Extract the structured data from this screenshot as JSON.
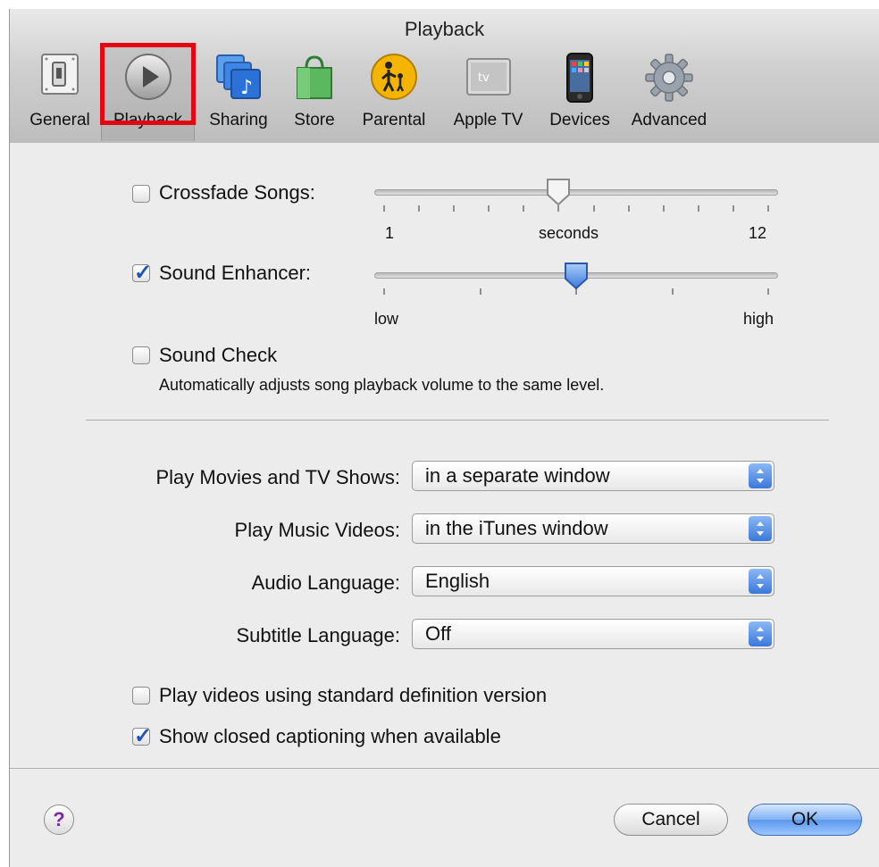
{
  "window": {
    "title": "Playback"
  },
  "toolbar": {
    "items": [
      {
        "label": "General",
        "icon": "switch-icon"
      },
      {
        "label": "Playback",
        "icon": "play-icon"
      },
      {
        "label": "Sharing",
        "icon": "sharing-icon"
      },
      {
        "label": "Store",
        "icon": "shopping-bag-icon"
      },
      {
        "label": "Parental",
        "icon": "parental-icon"
      },
      {
        "label": "Apple TV",
        "icon": "apple-tv-icon"
      },
      {
        "label": "Devices",
        "icon": "iphone-icon"
      },
      {
        "label": "Advanced",
        "icon": "gear-icon"
      }
    ],
    "selected": "Playback",
    "highlight_color": "#e30613"
  },
  "crossfade": {
    "label": "Crossfade Songs:",
    "checked": false,
    "min_label": "1",
    "mid_label": "seconds",
    "max_label": "12",
    "value": 6
  },
  "sound_enhancer": {
    "label": "Sound Enhancer:",
    "checked": true,
    "min_label": "low",
    "max_label": "high",
    "value_fraction": 0.5
  },
  "sound_check": {
    "label": "Sound Check",
    "checked": false,
    "description": "Automatically adjusts song playback volume to the same level."
  },
  "popups": [
    {
      "label": "Play Movies and TV Shows:",
      "value": "in a separate window"
    },
    {
      "label": "Play Music Videos:",
      "value": "in the iTunes window"
    },
    {
      "label": "Audio Language:",
      "value": "English"
    },
    {
      "label": "Subtitle Language:",
      "value": "Off"
    }
  ],
  "options": [
    {
      "label": "Play videos using standard definition version",
      "checked": false
    },
    {
      "label": "Show closed captioning when available",
      "checked": true
    }
  ],
  "buttons": {
    "help": "?",
    "cancel": "Cancel",
    "ok": "OK"
  },
  "colors": {
    "accent": "#3a78da",
    "check": "#1f55b6"
  }
}
